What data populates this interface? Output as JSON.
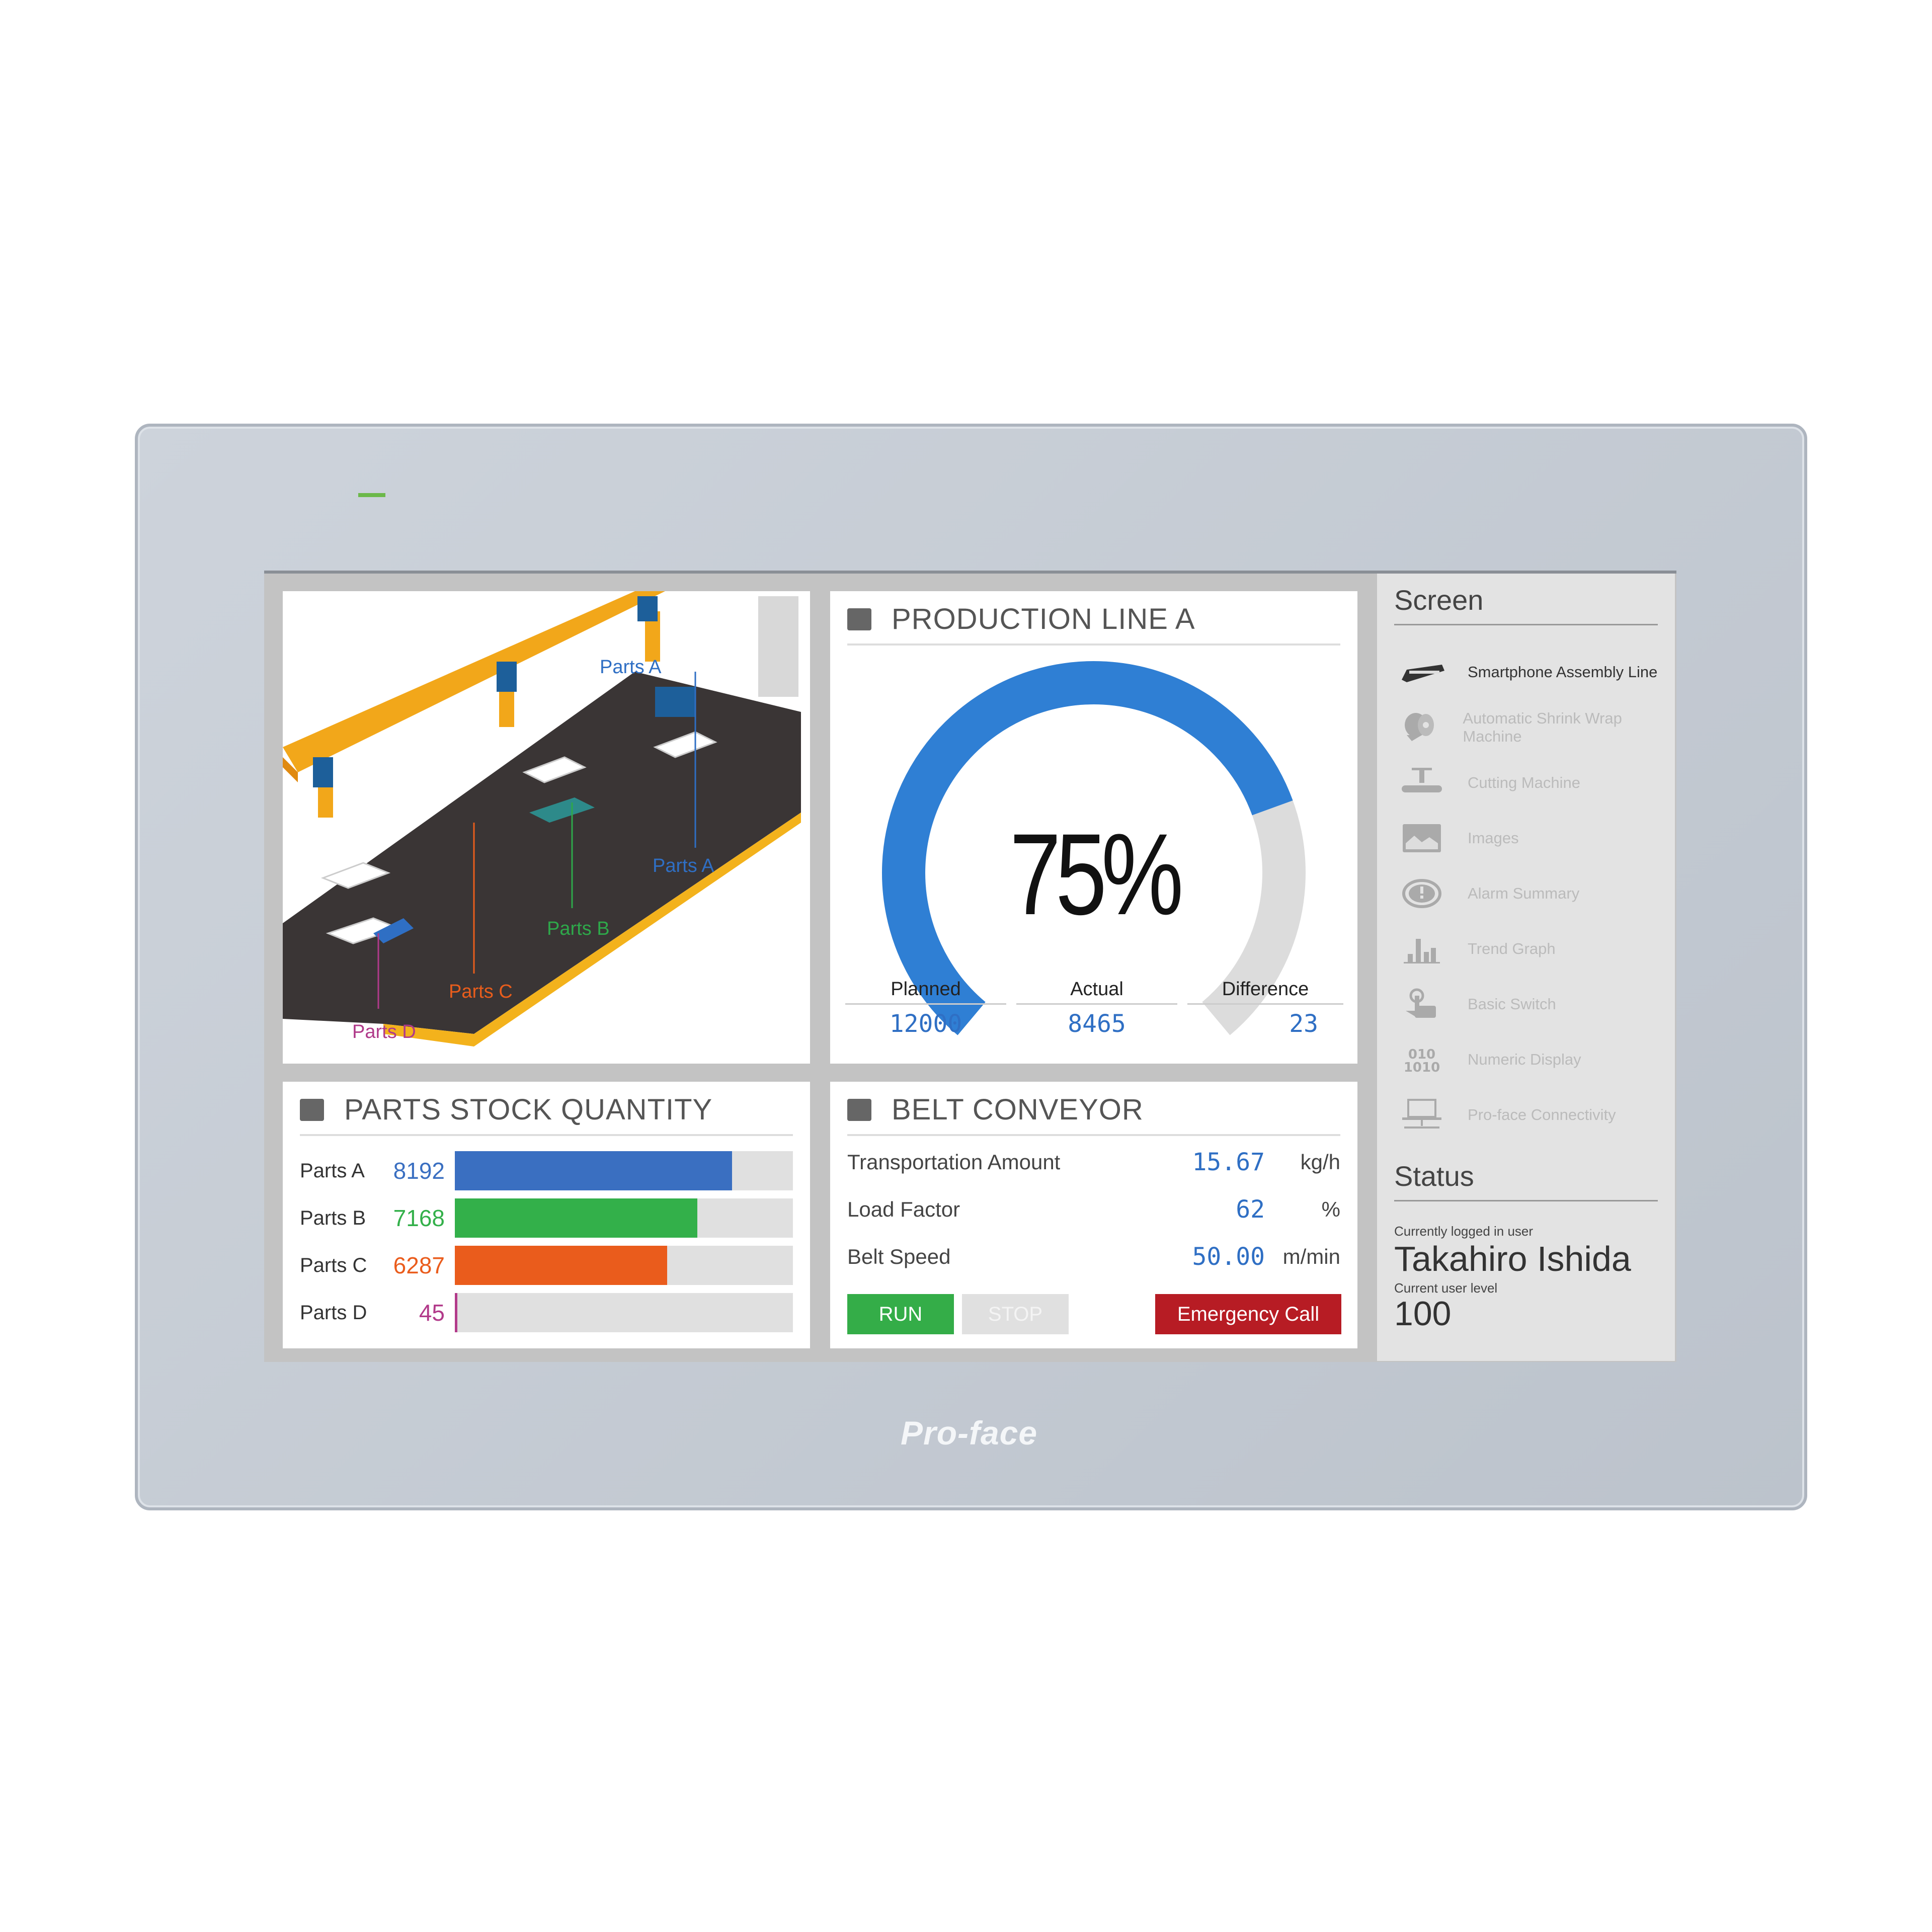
{
  "brand": "Pro-face",
  "illustration": {
    "labels": [
      {
        "text": "Parts A",
        "color": "#2f6fc4"
      },
      {
        "text": "Parts A",
        "color": "#2f6fc4"
      },
      {
        "text": "Parts B",
        "color": "#2ea84a"
      },
      {
        "text": "Parts C",
        "color": "#e85d1c"
      },
      {
        "text": "Parts D",
        "color": "#b03a8a"
      }
    ]
  },
  "production": {
    "title": "PRODUCTION LINE A",
    "percent_label": "75%",
    "percent": 75,
    "planned_label": "Planned",
    "planned": "12000",
    "actual_label": "Actual",
    "actual": "8465",
    "difference_label": "Difference",
    "difference": "23",
    "colors": {
      "gauge": "#2f7fd4",
      "track": "#dcdcdc"
    }
  },
  "stock": {
    "title": "PARTS STOCK QUANTITY",
    "max": 10000,
    "items": [
      {
        "name": "Parts A",
        "value": "8192",
        "color": "#3a6fc1"
      },
      {
        "name": "Parts B",
        "value": "7168",
        "color": "#33b04a"
      },
      {
        "name": "Parts C",
        "value": "6287",
        "color": "#ea5c1c"
      },
      {
        "name": "Parts D",
        "value": "45",
        "color": "#b23a8a"
      }
    ]
  },
  "belt": {
    "title": "BELT CONVEYOR",
    "rows": [
      {
        "label": "Transportation Amount",
        "value": "15.67",
        "unit": "kg/h"
      },
      {
        "label": "Load Factor",
        "value": "62",
        "unit": "%"
      },
      {
        "label": "Belt Speed",
        "value": "50.00",
        "unit": "m/min"
      }
    ],
    "run": "RUN",
    "stop": "STOP",
    "emergency": "Emergency Call"
  },
  "sidebar": {
    "screen_title": "Screen",
    "items": [
      {
        "label": "Smartphone Assembly Line",
        "icon": "conveyor-icon",
        "active": true
      },
      {
        "label": "Automatic Shrink Wrap Machine",
        "icon": "film-roll-icon"
      },
      {
        "label": "Cutting Machine",
        "icon": "cutter-icon"
      },
      {
        "label": "Images",
        "icon": "image-icon"
      },
      {
        "label": "Alarm Summary",
        "icon": "alarm-icon"
      },
      {
        "label": "Trend Graph",
        "icon": "bar-chart-icon"
      },
      {
        "label": "Basic Switch",
        "icon": "hand-pointer-icon"
      },
      {
        "label": "Numeric Display",
        "icon": "numeric-icon"
      },
      {
        "label": "Pro-face Connectivity",
        "icon": "laptop-network-icon"
      }
    ],
    "status_title": "Status",
    "user_label": "Currently logged in user",
    "user": "Takahiro Ishida",
    "level_label": "Current user level",
    "level": "100"
  }
}
